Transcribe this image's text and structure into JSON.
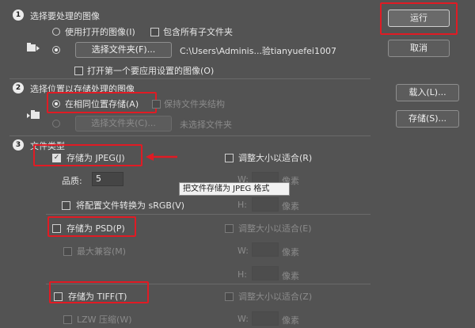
{
  "section1": {
    "num": "1",
    "title": "选择要处理的图像",
    "use_open_label": "使用打开的图像(I)",
    "include_subfolders_label": "包含所有子文件夹",
    "choose_folder_label": "选择文件夹(F)...",
    "path": "C:\\Users\\Adminis...验tianyuefei1007",
    "open_first_label": "打开第一个要应用设置的图像(O)"
  },
  "section2": {
    "num": "2",
    "title": "选择位置以存储处理的图像",
    "same_location_label": "在相同位置存储(A)",
    "keep_structure_label": "保持文件夹结构",
    "choose_folder_label": "选择文件夹(C)...",
    "no_folder_label": "未选择文件夹"
  },
  "section3": {
    "num": "3",
    "title": "文件类型",
    "jpeg": {
      "save_label": "存储为 JPEG(J)",
      "resize_label": "调整大小以适合(R)",
      "quality_label": "品质:",
      "quality_value": "5",
      "w_label": "W:",
      "h_label": "H:",
      "unit": "像素",
      "convert_label": "将配置文件转换为 sRGB(V)",
      "tooltip": "把文件存储为 JPEG 格式"
    },
    "psd": {
      "save_label": "存储为 PSD(P)",
      "resize_label": "调整大小以适合(E)",
      "max_compat_label": "最大兼容(M)",
      "w_label": "W:",
      "h_label": "H:",
      "unit": "像素"
    },
    "tiff": {
      "save_label": "存储为 TIFF(T)",
      "resize_label": "调整大小以适合(Z)",
      "lzw_label": "LZW 压缩(W)",
      "w_label": "W:",
      "unit": "像素"
    }
  },
  "buttons": {
    "run": "运行",
    "cancel": "取消",
    "load": "载入(L)...",
    "save": "存储(S)..."
  },
  "colors": {
    "background": "#535353",
    "highlight": "#e01b24"
  }
}
